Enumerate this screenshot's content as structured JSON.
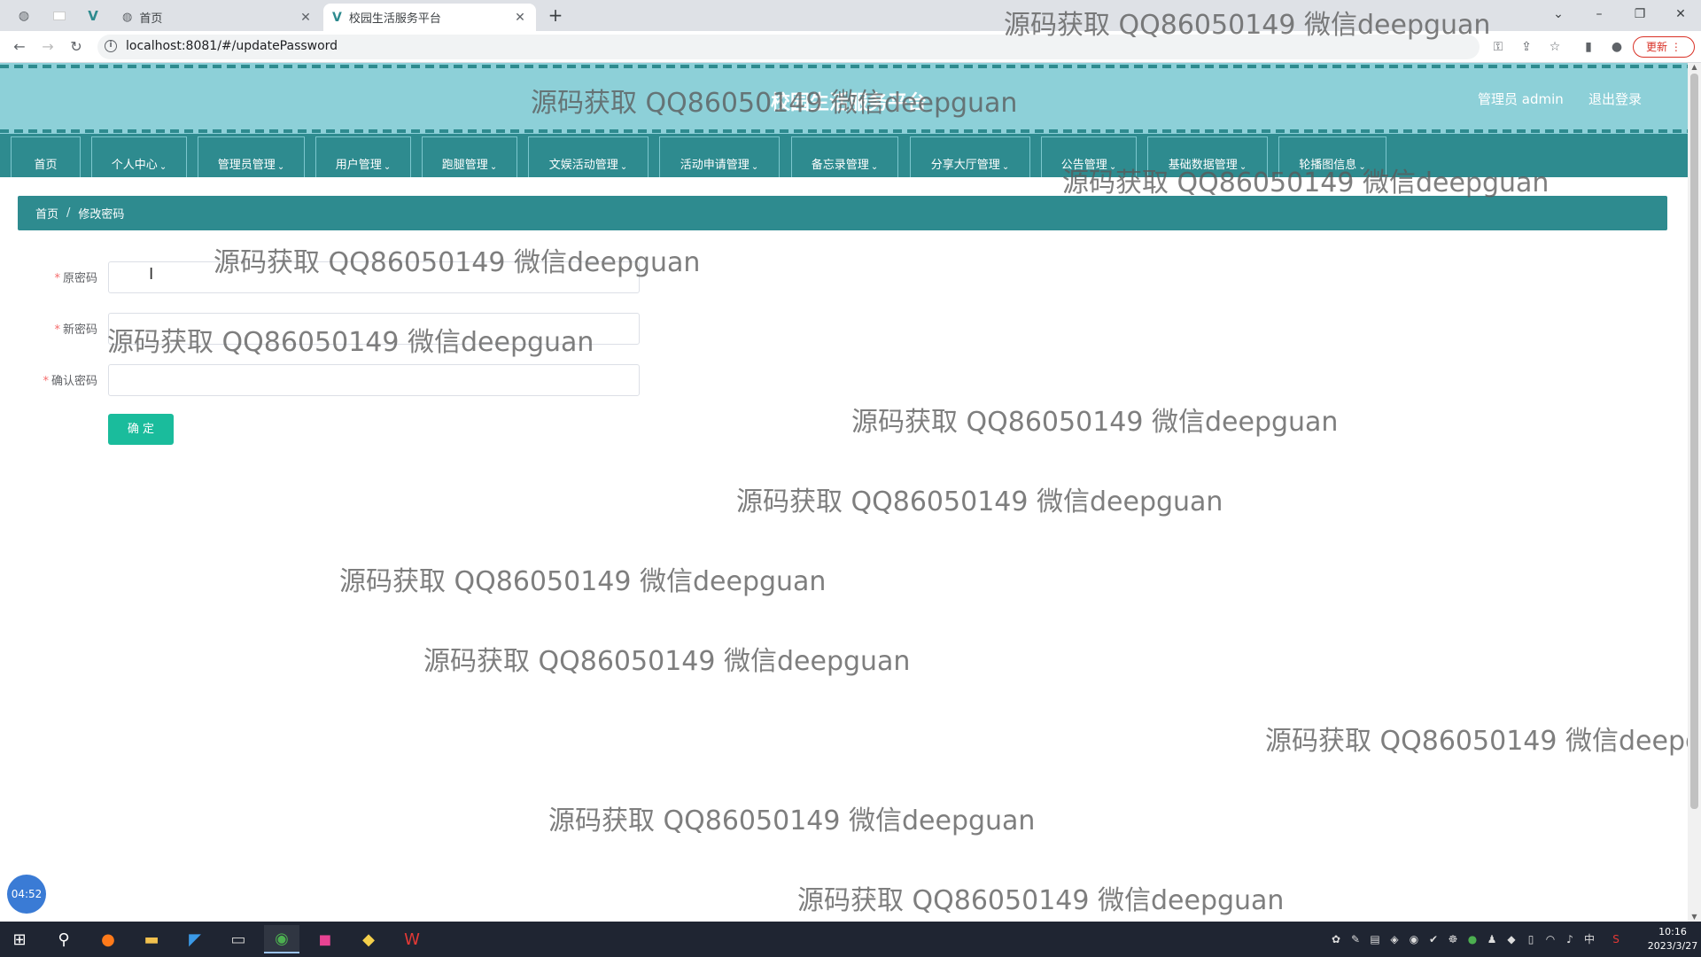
{
  "browser": {
    "tabs": [
      {
        "title": "首页",
        "icon": "globe-icon"
      },
      {
        "title": "校园生活服务平台",
        "icon": "vue-icon"
      }
    ],
    "url": "localhost:8081/#/updatePassword",
    "update_label": "更新"
  },
  "header": {
    "title": "校园生活服务平台",
    "user": "管理员 admin",
    "logout": "退出登录"
  },
  "nav": {
    "items": [
      {
        "label": "首页",
        "dropdown": false
      },
      {
        "label": "个人中心",
        "dropdown": true
      },
      {
        "label": "管理员管理",
        "dropdown": true
      },
      {
        "label": "用户管理",
        "dropdown": true
      },
      {
        "label": "跑腿管理",
        "dropdown": true
      },
      {
        "label": "文娱活动管理",
        "dropdown": true
      },
      {
        "label": "活动申请管理",
        "dropdown": true
      },
      {
        "label": "备忘录管理",
        "dropdown": true
      },
      {
        "label": "分享大厅管理",
        "dropdown": true
      },
      {
        "label": "公告管理",
        "dropdown": true
      },
      {
        "label": "基础数据管理",
        "dropdown": true
      },
      {
        "label": "轮播图信息",
        "dropdown": true
      }
    ],
    "chevron": "⌄"
  },
  "breadcrumb": {
    "home": "首页",
    "separator": "/",
    "current": "修改密码"
  },
  "form": {
    "required_mark": "*",
    "old_password_label": "原密码",
    "new_password_label": "新密码",
    "confirm_password_label": "确认密码",
    "submit_label": "确 定"
  },
  "watermark": {
    "text": "源码获取 QQ86050149 微信deepguan"
  },
  "timer": "04:52",
  "taskbar": {
    "time": "10:16",
    "date": "2023/3/27",
    "ime": "中"
  },
  "colors": {
    "header_bg": "#8dd0d8",
    "nav_bg": "#2e8b8f",
    "submit_bg": "#1abc9c",
    "required": "#f56c6c"
  }
}
